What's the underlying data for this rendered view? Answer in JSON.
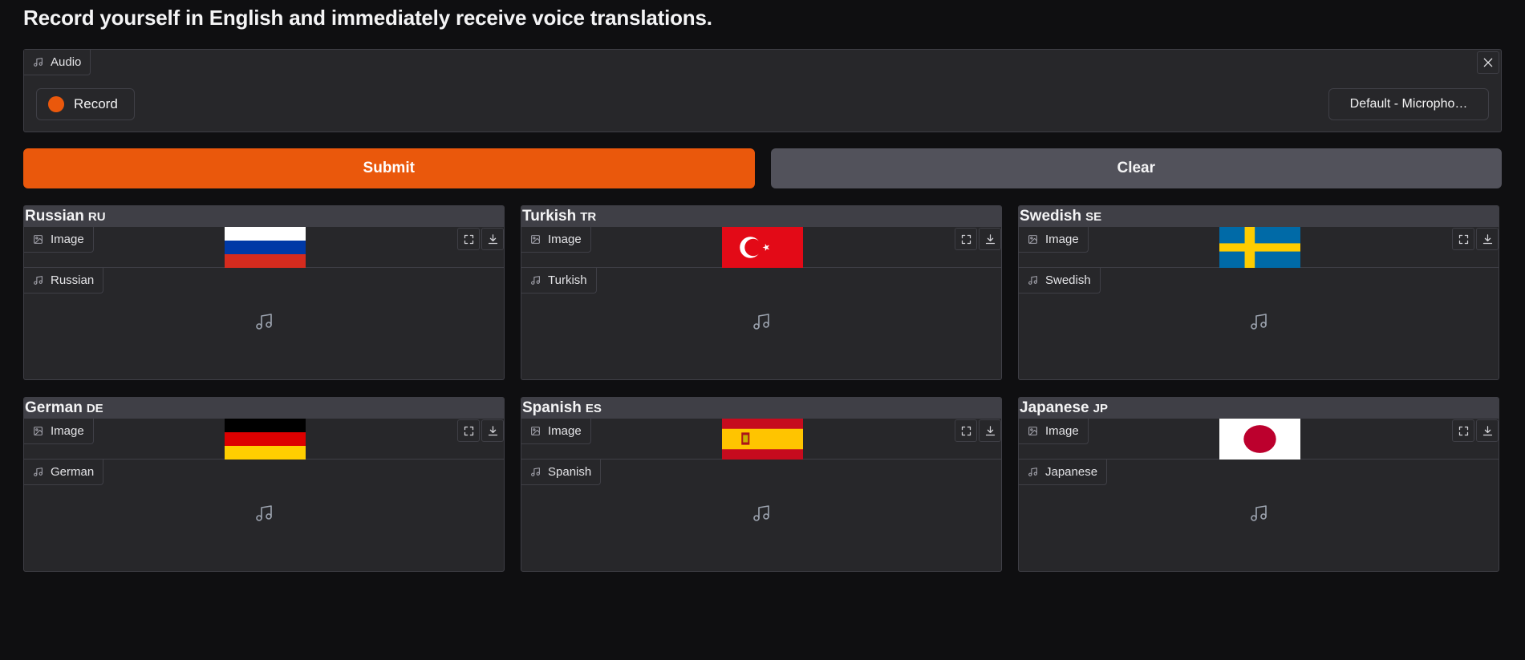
{
  "title": "Record yourself in English and immediately receive voice translations.",
  "audio_input": {
    "label": "Audio",
    "icon": "music-icon",
    "record_label": "Record",
    "mic_device": "Default - Micropho…"
  },
  "buttons": {
    "submit": "Submit",
    "clear": "Clear"
  },
  "colors": {
    "accent": "#ea580c",
    "panel": "#27272a",
    "header": "#3f3f46",
    "clear_button": "#52525b"
  },
  "languages": [
    {
      "name": "Russian",
      "code": "RU",
      "image_label": "Image",
      "audio_label": "Russian",
      "flag": "flag-russia-icon"
    },
    {
      "name": "Turkish",
      "code": "TR",
      "image_label": "Image",
      "audio_label": "Turkish",
      "flag": "flag-turkey-icon"
    },
    {
      "name": "Swedish",
      "code": "SE",
      "image_label": "Image",
      "audio_label": "Swedish",
      "flag": "flag-sweden-icon"
    },
    {
      "name": "German",
      "code": "DE",
      "image_label": "Image",
      "audio_label": "German",
      "flag": "flag-germany-icon"
    },
    {
      "name": "Spanish",
      "code": "ES",
      "image_label": "Image",
      "audio_label": "Spanish",
      "flag": "flag-spain-icon"
    },
    {
      "name": "Japanese",
      "code": "JP",
      "image_label": "Image",
      "audio_label": "Japanese",
      "flag": "flag-japan-icon"
    }
  ]
}
